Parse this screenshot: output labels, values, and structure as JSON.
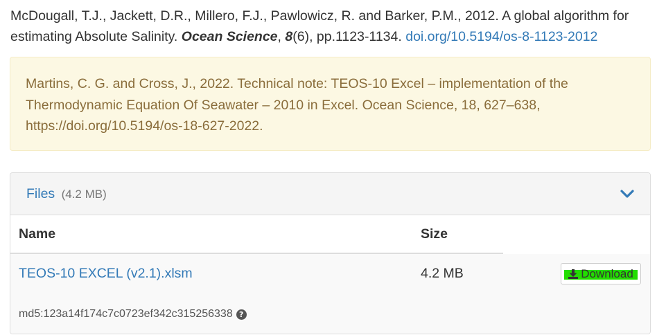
{
  "citation": {
    "authors_year": "McDougall, T.J., Jackett, D.R., Millero, F.J., Pawlowicz, R. and Barker, P.M., 2012. A global algorithm for estimating Absolute Salinity. ",
    "journal": "Ocean Science",
    "volume_sep": ", ",
    "volume": "8",
    "issue_pages": "(6), pp.1123-1134. ",
    "doi_link": "doi.org/10.5194/os-8-1123-2012"
  },
  "note": {
    "text": "Martins, C. G. and Cross, J., 2022. Technical note: TEOS-10 Excel – implementation of the Thermodynamic Equation Of Seawater – 2010 in Excel. Ocean Science, 18, 627–638, https://doi.org/10.5194/os-18-627-2022."
  },
  "files": {
    "title": "Files",
    "total_size": "(4.2 MB)",
    "toggle_icon": "chevron-down-icon",
    "columns": {
      "name": "Name",
      "size": "Size"
    },
    "rows": [
      {
        "name": "TEOS-10 EXCEL (v2.1).xlsm",
        "size": "4.2 MB",
        "download_label": "Download",
        "download_icon": "download-icon",
        "md5": "md5:123a14f174c7c0723ef342c315256338",
        "help_icon": "question-circle-icon"
      }
    ]
  },
  "colors": {
    "link": "#337ab7",
    "note_bg": "#fcf8e3",
    "note_text": "#8a6d3b",
    "highlight": "#22dd00"
  }
}
